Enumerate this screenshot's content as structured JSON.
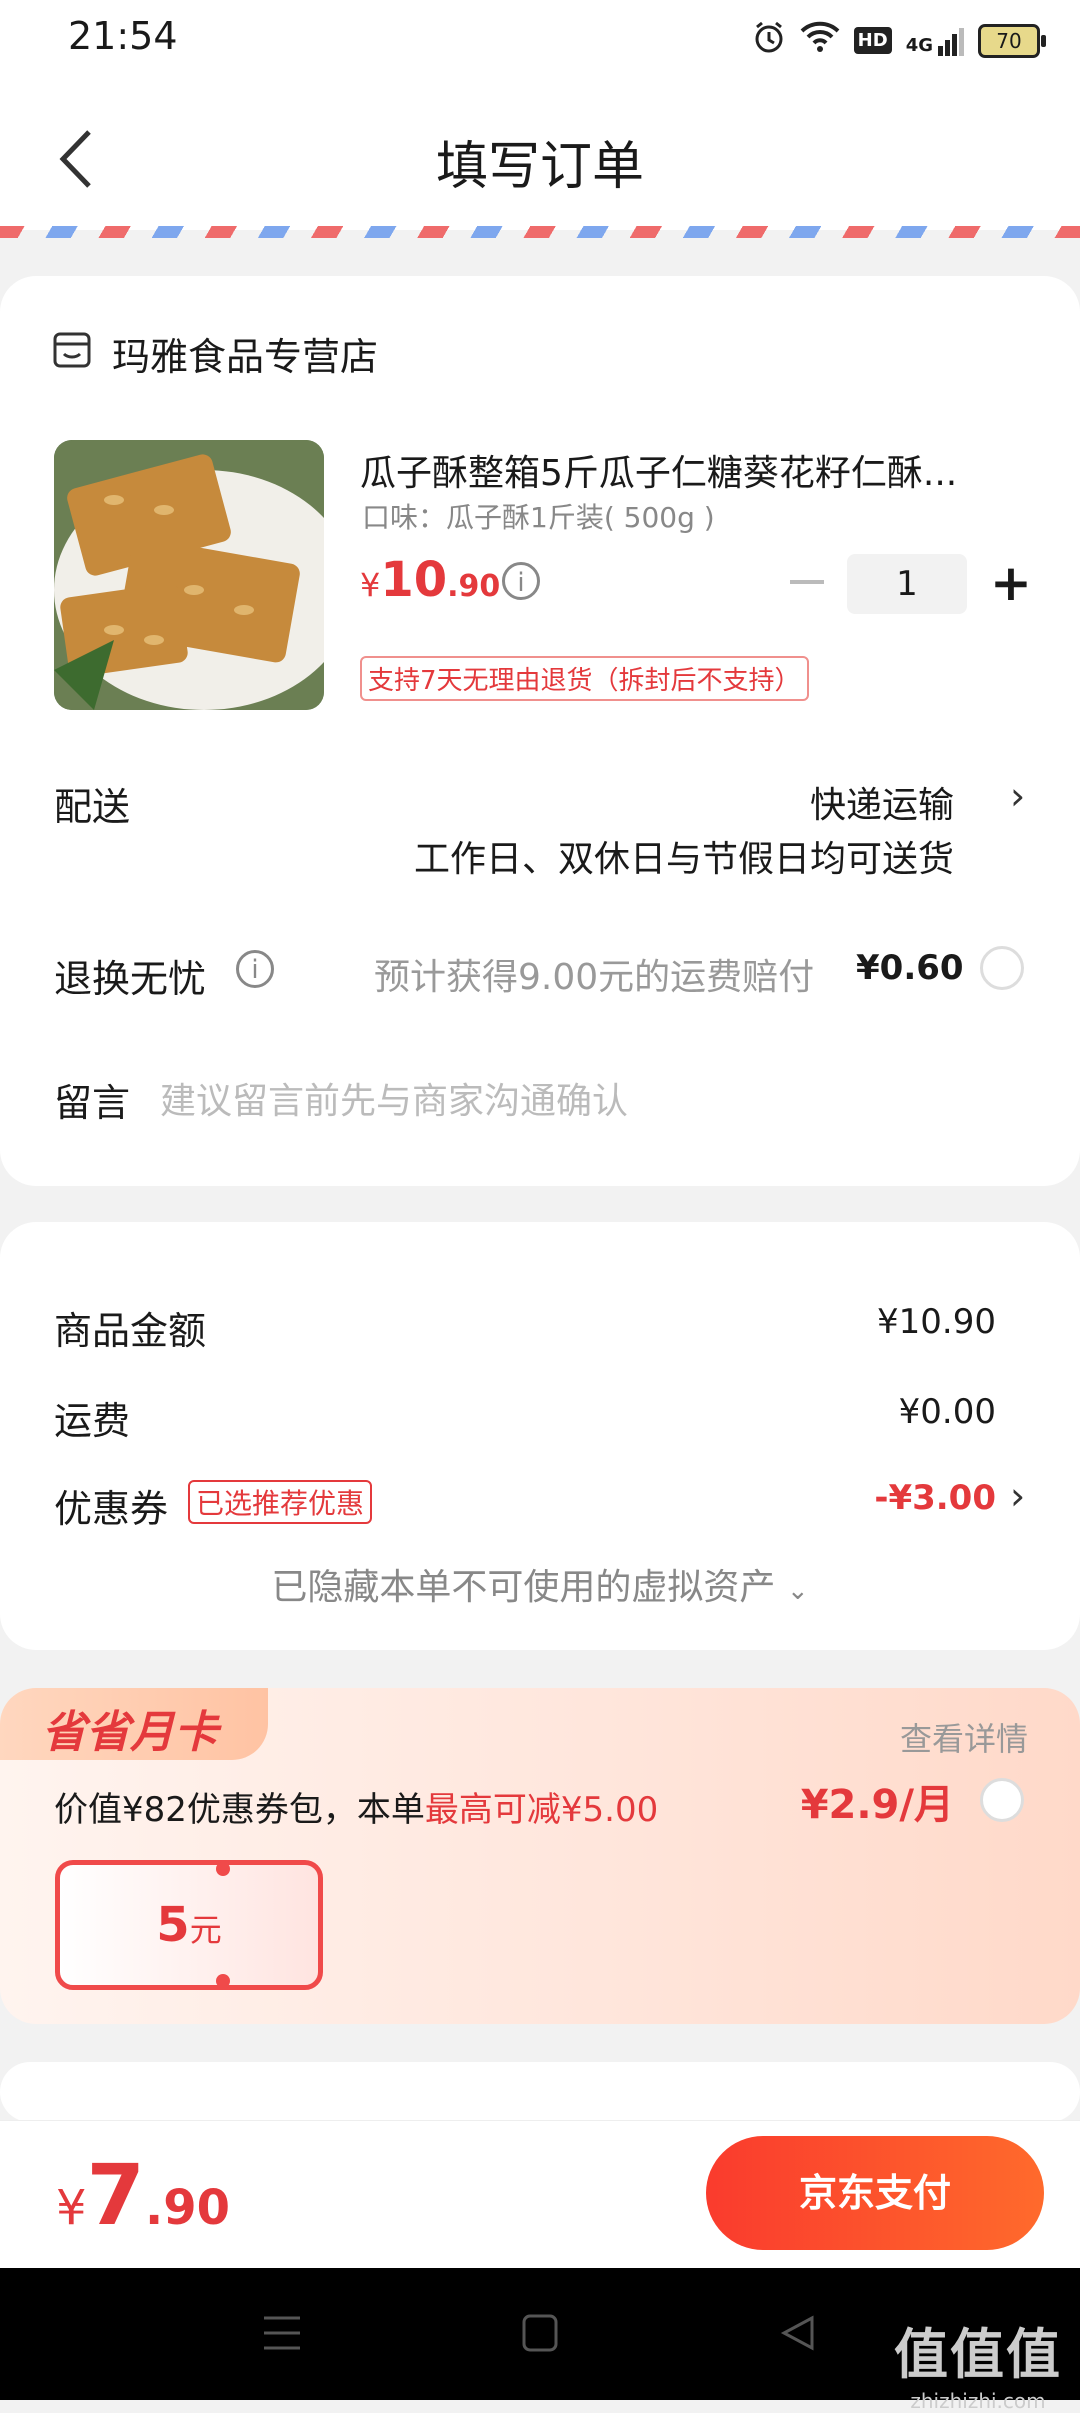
{
  "status_bar": {
    "time": "21:54",
    "battery": "70",
    "hd": "HD",
    "network": "4G"
  },
  "header": {
    "title": "填写订单"
  },
  "shop": {
    "name": "玛雅食品专营店"
  },
  "product": {
    "title": "瓜子酥整箱5斤瓜子仁糖葵花籽仁酥...",
    "spec": "口味：瓜子酥1斤装( 500g )",
    "price_symbol": "¥",
    "price_int": "10",
    "price_dec": ".90",
    "quantity": "1",
    "return_tag": "支持7天无理由退货（拆封后不支持）"
  },
  "delivery": {
    "label": "配送",
    "method": "快递运输",
    "desc": "工作日、双休日与节假日均可送货"
  },
  "return_worry": {
    "label": "退换无忧",
    "desc": "预计获得9.00元的运费赔付",
    "price": "¥0.60"
  },
  "message": {
    "label": "留言",
    "placeholder": "建议留言前先与商家沟通确认"
  },
  "summary": {
    "goods_label": "商品金额",
    "goods_value": "¥10.90",
    "shipping_label": "运费",
    "shipping_value": "¥0.00",
    "coupon_label": "优惠券",
    "coupon_tag": "已选推荐优惠",
    "coupon_value": "-¥3.00",
    "hidden_assets": "已隐藏本单不可使用的虚拟资产"
  },
  "month_card": {
    "badge": "省省月卡",
    "view_details": "查看详情",
    "desc_prefix": "价值¥82优惠券包，本单",
    "desc_highlight": "最高可减¥5.00",
    "price": "¥2.9/月",
    "voucher_num": "5",
    "voucher_unit": "元"
  },
  "footer": {
    "total_symbol": "¥",
    "total_int": "7",
    "total_dec": ".90",
    "pay_label": "京东支付"
  },
  "watermark": {
    "big": "值值值",
    "small": "zhizhizhi.com"
  },
  "colors": {
    "accent": "#e4393c",
    "pay_gradient_start": "#fa3b2d",
    "pay_gradient_end": "#ff6a2c"
  }
}
